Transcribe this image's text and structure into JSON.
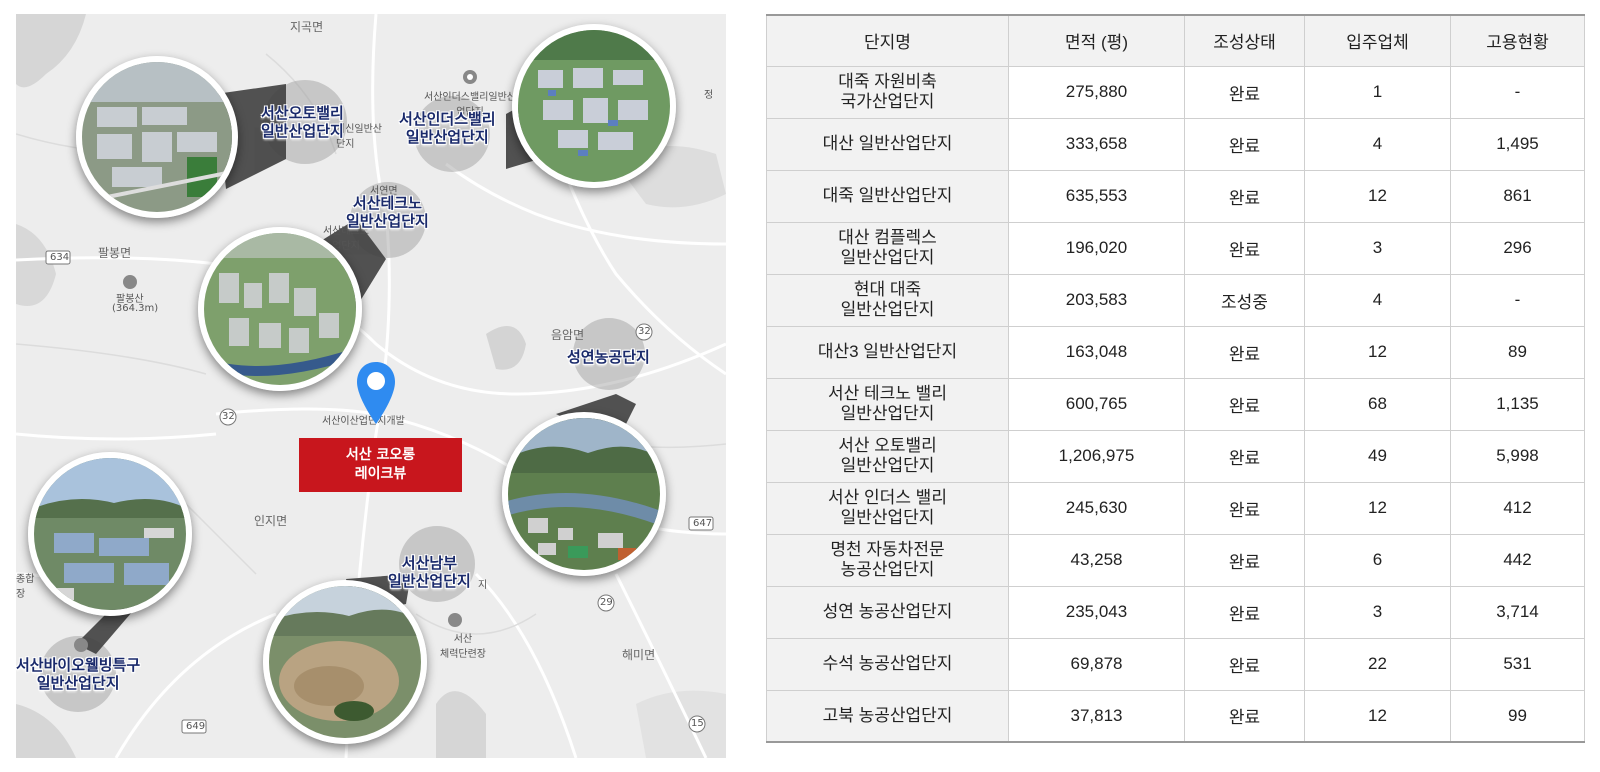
{
  "map": {
    "places": {
      "jigok": "지곡면",
      "palbong": "팔봉면",
      "palbong_mt": "팔봉산",
      "palbong_mt_height": "(364.3m)",
      "eumam": "음암면",
      "seoyeon": "서연면",
      "inji": "인지면",
      "haemi": "해미면",
      "sports": "서산\n체력단련장",
      "jeong": "정",
      "jiphap": "종합\n장",
      "ieup": "서산이산업단지개발",
      "seosin_sub": "서신일반산\n단지",
      "indus_sub": "서산인더스밸리일반산\n업단지",
      "techno_sub": "서산테크노\n업단지",
      "nambu_sub": "지"
    },
    "road_numbers": [
      "634",
      "32",
      "32",
      "647",
      "649",
      "29",
      "15"
    ],
    "zones": {
      "auto": [
        "서산오토밸리",
        "일반산업단지"
      ],
      "indus": [
        "서산인더스밸리",
        "일반산업단지"
      ],
      "techno": [
        "서산테크노",
        "일반산업단지"
      ],
      "seongyeon": [
        "성연농공단지"
      ],
      "nambu": [
        "서산남부",
        "일반산업단지"
      ],
      "bio": [
        "서산바이오웰빙특구",
        "일반산업단지"
      ]
    },
    "marker": [
      "서산 코오롱",
      "레이크뷰"
    ]
  },
  "table": {
    "headers": [
      "단지명",
      "면적 (평)",
      "조성상태",
      "입주업체",
      "고용현황"
    ],
    "rows": [
      [
        [
          "대죽 자원비축",
          "국가산업단지"
        ],
        "275,880",
        "완료",
        "1",
        "-"
      ],
      [
        [
          "대산 일반산업단지"
        ],
        "333,658",
        "완료",
        "4",
        "1,495"
      ],
      [
        [
          "대죽 일반산업단지"
        ],
        "635,553",
        "완료",
        "12",
        "861"
      ],
      [
        [
          "대산 컴플렉스",
          "일반산업단지"
        ],
        "196,020",
        "완료",
        "3",
        "296"
      ],
      [
        [
          "현대 대죽",
          "일반산업단지"
        ],
        "203,583",
        "조성중",
        "4",
        "-"
      ],
      [
        [
          "대산3 일반산업단지"
        ],
        "163,048",
        "완료",
        "12",
        "89"
      ],
      [
        [
          "서산 테크노 밸리",
          "일반산업단지"
        ],
        "600,765",
        "완료",
        "68",
        "1,135"
      ],
      [
        [
          "서산 오토밸리",
          "일반산업단지"
        ],
        "1,206,975",
        "완료",
        "49",
        "5,998"
      ],
      [
        [
          "서산 인더스 밸리",
          "일반산업단지"
        ],
        "245,630",
        "완료",
        "12",
        "412"
      ],
      [
        [
          "명천 자동차전문",
          "농공산업단지"
        ],
        "43,258",
        "완료",
        "6",
        "442"
      ],
      [
        [
          "성연 농공산업단지"
        ],
        "235,043",
        "완료",
        "3",
        "3,714"
      ],
      [
        [
          "수석 농공산업단지"
        ],
        "69,878",
        "완료",
        "22",
        "531"
      ],
      [
        [
          "고북 농공산업단지"
        ],
        "37,813",
        "완료",
        "12",
        "99"
      ]
    ]
  },
  "colors": {
    "marker_red": "#c8161d",
    "zone_text": "#1a2a6b",
    "pin_blue": "#2f8bf0",
    "header_bg": "#f2f2f2"
  }
}
